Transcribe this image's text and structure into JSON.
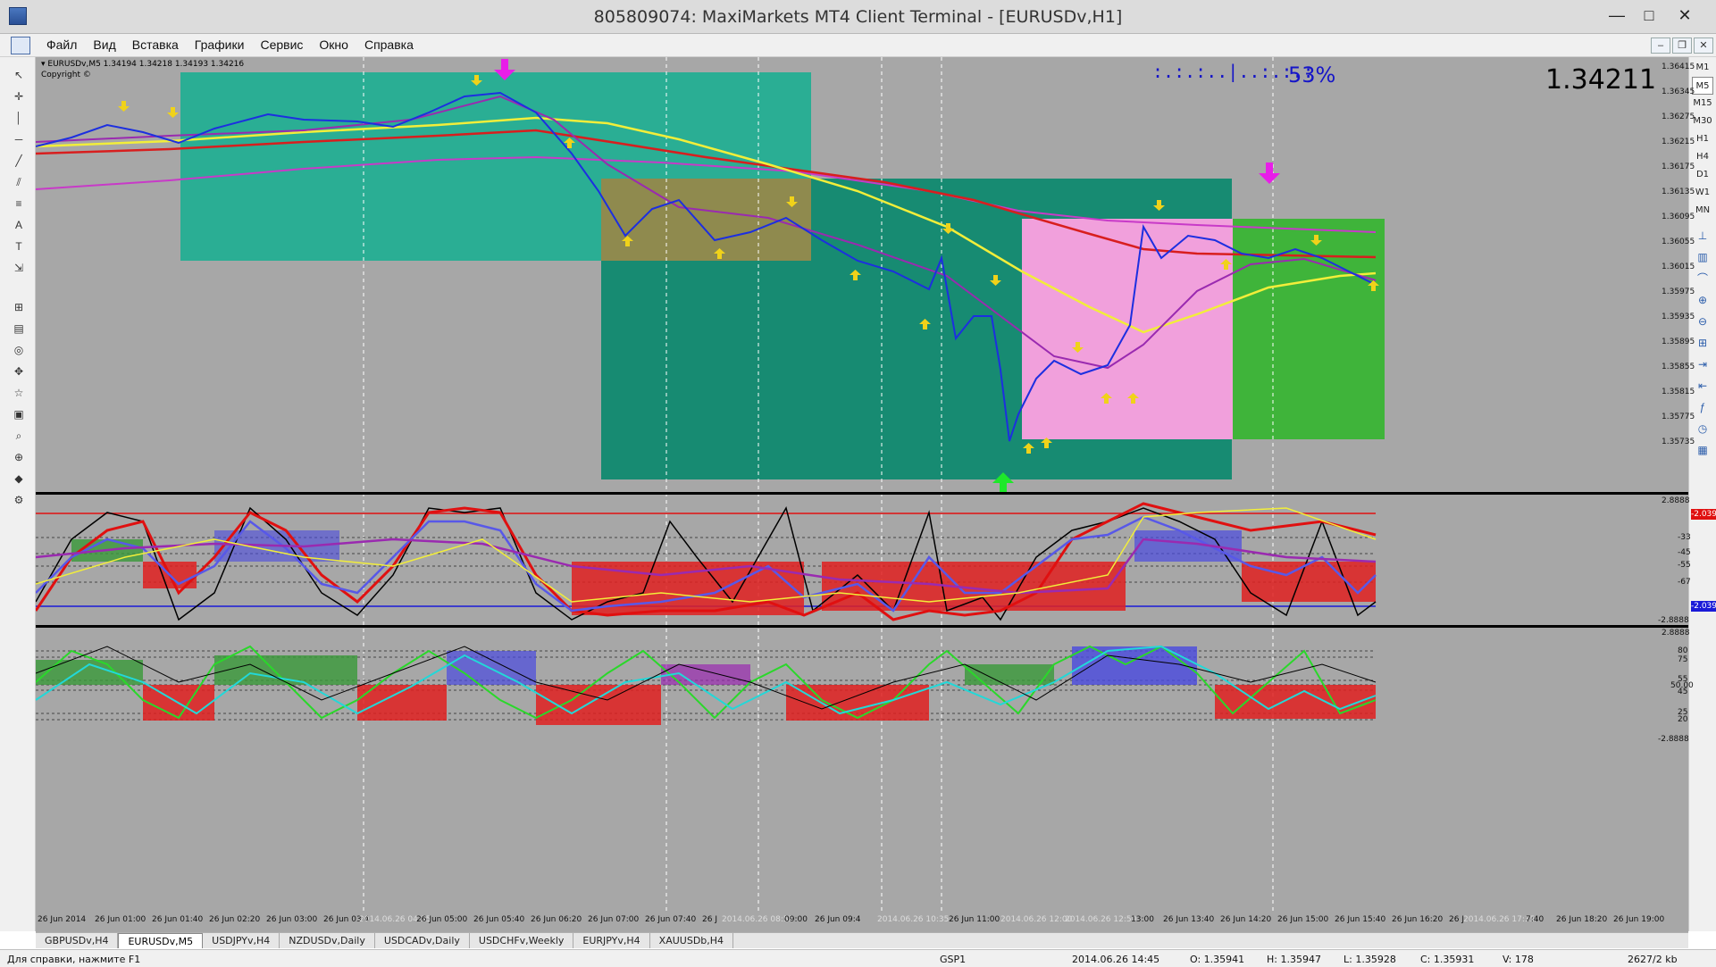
{
  "window": {
    "title": "805809074: MaxiMarkets MT4 Client Terminal - [EURUSDv,H1]",
    "minimize": "—",
    "maximize": "□",
    "close": "✕"
  },
  "menu": [
    "Файл",
    "Вид",
    "Вставка",
    "Графики",
    "Сервис",
    "Окно",
    "Справка"
  ],
  "mdi_buttons": [
    "–",
    "❐",
    "✕"
  ],
  "timeframes": [
    "M1",
    "M5",
    "M15",
    "M30",
    "H1",
    "H4",
    "D1",
    "W1",
    "MN"
  ],
  "chart": {
    "info_line": "▾ EURUSDv,M5  1.34194 1.34218 1.34193 1.34216",
    "copyright": "Copyright ©",
    "big_price": "1.34211",
    "percent": "53%",
    "dots_indicator": ":.:.:..|..:.:.:",
    "price_axis": [
      "1.36415",
      "1.36345",
      "1.36275",
      "1.36215",
      "1.36175",
      "1.36135",
      "1.36095",
      "1.36055",
      "1.36015",
      "1.35975",
      "1.35935",
      "1.35895",
      "1.35855",
      "1.35815",
      "1.35775",
      "1.35735"
    ],
    "ind1_axis": [
      "2.8888",
      "-2.03915",
      "-33",
      "-45",
      "-55",
      "-67",
      "-2.03915",
      "-2.8888"
    ],
    "ind2_axis": [
      "2.8888",
      "80",
      "75",
      "55",
      "50.00",
      "45",
      "25",
      "20",
      "-2.8888"
    ],
    "time_axis": [
      "26 Jun 2014",
      "26 Jun 01:00",
      "26 Jun 01:40",
      "26 Jun 02:20",
      "26 Jun 03:00",
      "26 Jun 03:4",
      "2014.06.26 04:35",
      "26 Jun 05:00",
      "26 Jun 05:40",
      "26 Jun 06:20",
      "26 Jun 07:00",
      "26 Jun 07:40",
      "26 J",
      "2014.06.26 08:55",
      "09:00",
      "26 Jun 09:4",
      "2014.06.26 10:35",
      "26 Jun 11:00",
      "2014.06.26 12:00",
      "2014.06.26 12:50",
      "13:00",
      "26 Jun 13:40",
      "26 Jun 14:20",
      "26 Jun 15:00",
      "26 Jun 15:40",
      "26 Jun 16:20",
      "26 J",
      "2014.06.26 17:35",
      "7:40",
      "26 Jun 18:20",
      "26 Jun 19:00"
    ]
  },
  "tabs": [
    "GBPUSDv,H4",
    "EURUSDv,M5",
    "USDJPYv,H4",
    "NZDUSDv,Daily",
    "USDCADv,Daily",
    "USDCHFv,Weekly",
    "EURJPYv,H4",
    "XAUUSDb,H4"
  ],
  "status": {
    "help": "Для справки, нажмите F1",
    "profile": "GSP1",
    "datetime": "2014.06.26 14:45",
    "open": "O: 1.35941",
    "high": "H: 1.35947",
    "low": "L: 1.35928",
    "close": "C: 1.35931",
    "volume": "V: 178",
    "traffic": "2627/2 kb"
  },
  "colors": {
    "chart_bg": "#a7a7a7",
    "box_teal": "#2aae94",
    "box_darkteal": "#178b72",
    "box_olive": "#8f8a4e",
    "box_pink": "#f1a0dc",
    "box_green": "#3fb43a",
    "ma_red": "#d81e1e",
    "ma_yellow": "#f2ee3a",
    "ma_magenta": "#c83ac8",
    "ma_purple": "#9a2ab0",
    "price_blue": "#1c2fe0",
    "arrow_yellow": "#f0d21a",
    "arrow_magenta": "#e81ee8",
    "arrow_green": "#1ee82a"
  }
}
